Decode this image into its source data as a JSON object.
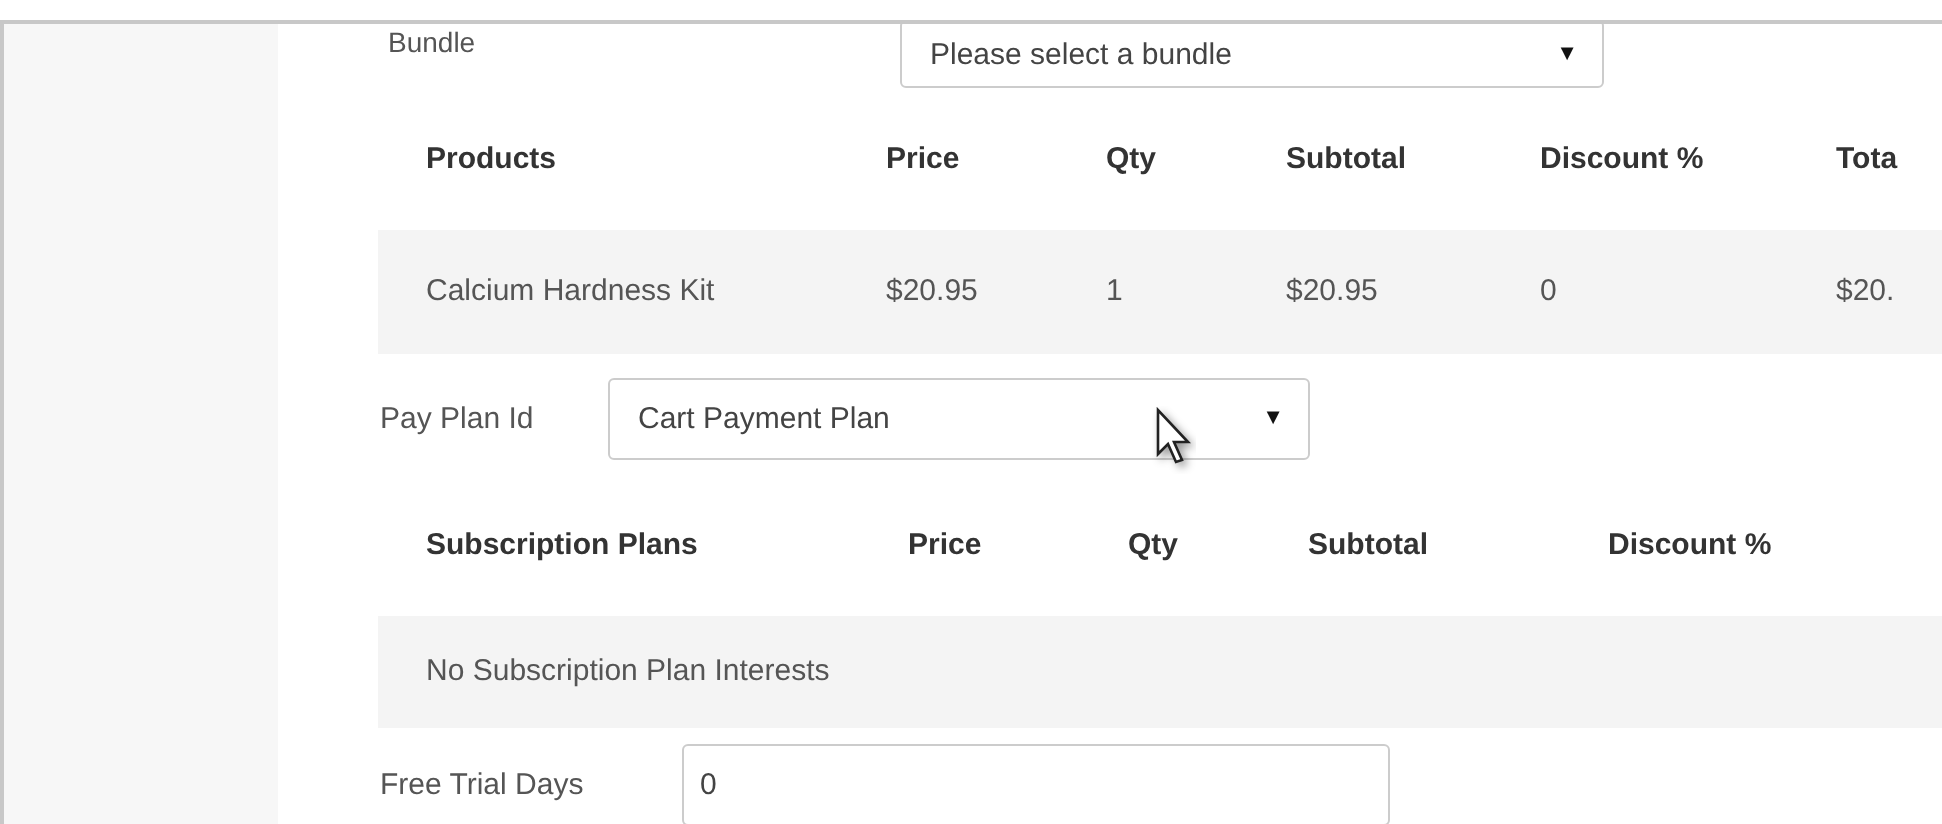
{
  "bundle": {
    "label": "Bundle",
    "value": "Please select a bundle",
    "arrow": "▼"
  },
  "products_table": {
    "columns": [
      "Products",
      "Price",
      "Qty",
      "Subtotal",
      "Discount %",
      "Tota"
    ],
    "rows": [
      [
        "Calcium Hardness Kit",
        "$20.95",
        "1",
        "$20.95",
        "0",
        "$20."
      ]
    ]
  },
  "pay_plan": {
    "label": "Pay Plan Id",
    "value": "Cart Payment Plan",
    "arrow": "▼"
  },
  "subscription_table": {
    "columns": [
      "Subscription Plans",
      "Price",
      "Qty",
      "Subtotal",
      "Discount %"
    ],
    "empty_message": "No Subscription Plan Interests"
  },
  "free_trial": {
    "label": "Free Trial Days",
    "value": "0"
  }
}
